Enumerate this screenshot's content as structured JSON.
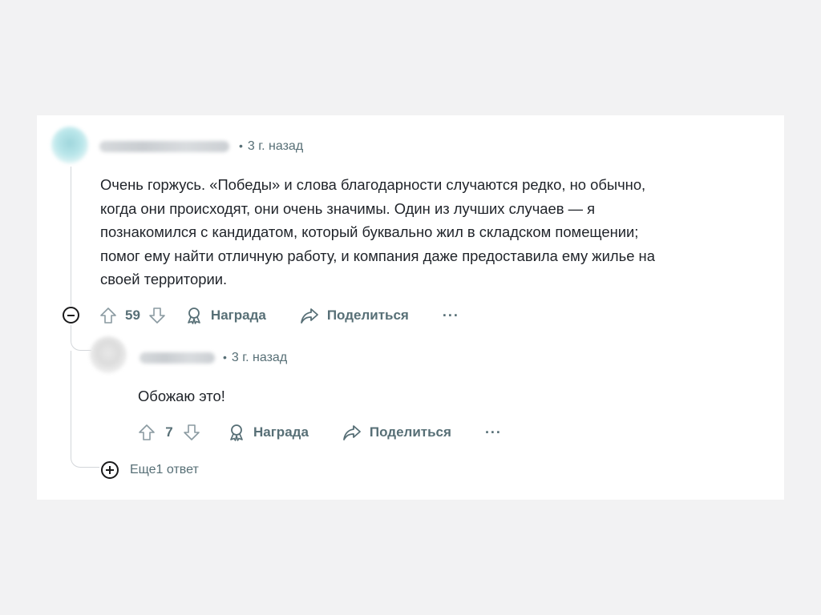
{
  "comment": {
    "meta": "3 г. назад",
    "body_lines": [
      "Очень горжусь. «Победы» и слова благодарности случаются редко, но обычно,",
      "когда они происходят, они очень значимы. Один из лучших случаев — я",
      "познакомился с кандидатом, который буквально жил в складском помещении;",
      "помог ему найти отличную работу, и компания даже предоставила ему жилье на",
      "своей территории."
    ],
    "score": "59",
    "award_label": "Награда",
    "share_label": "Поделиться",
    "more_label": "···"
  },
  "reply": {
    "meta": "3 г. назад",
    "body": "Обожаю это!",
    "score": "7",
    "award_label": "Награда",
    "share_label": "Поделиться",
    "more_label": "···"
  },
  "more_replies_label": "Еще1 ответ",
  "icons": {
    "upvote": "arrow-up-icon",
    "downvote": "arrow-down-icon",
    "award": "award-icon",
    "share": "share-icon",
    "collapse": "minus-circle-icon",
    "expand": "plus-circle-icon"
  },
  "colors": {
    "text": "#1a1a1b",
    "meta": "#576f76",
    "thread": "#d3d6da"
  }
}
